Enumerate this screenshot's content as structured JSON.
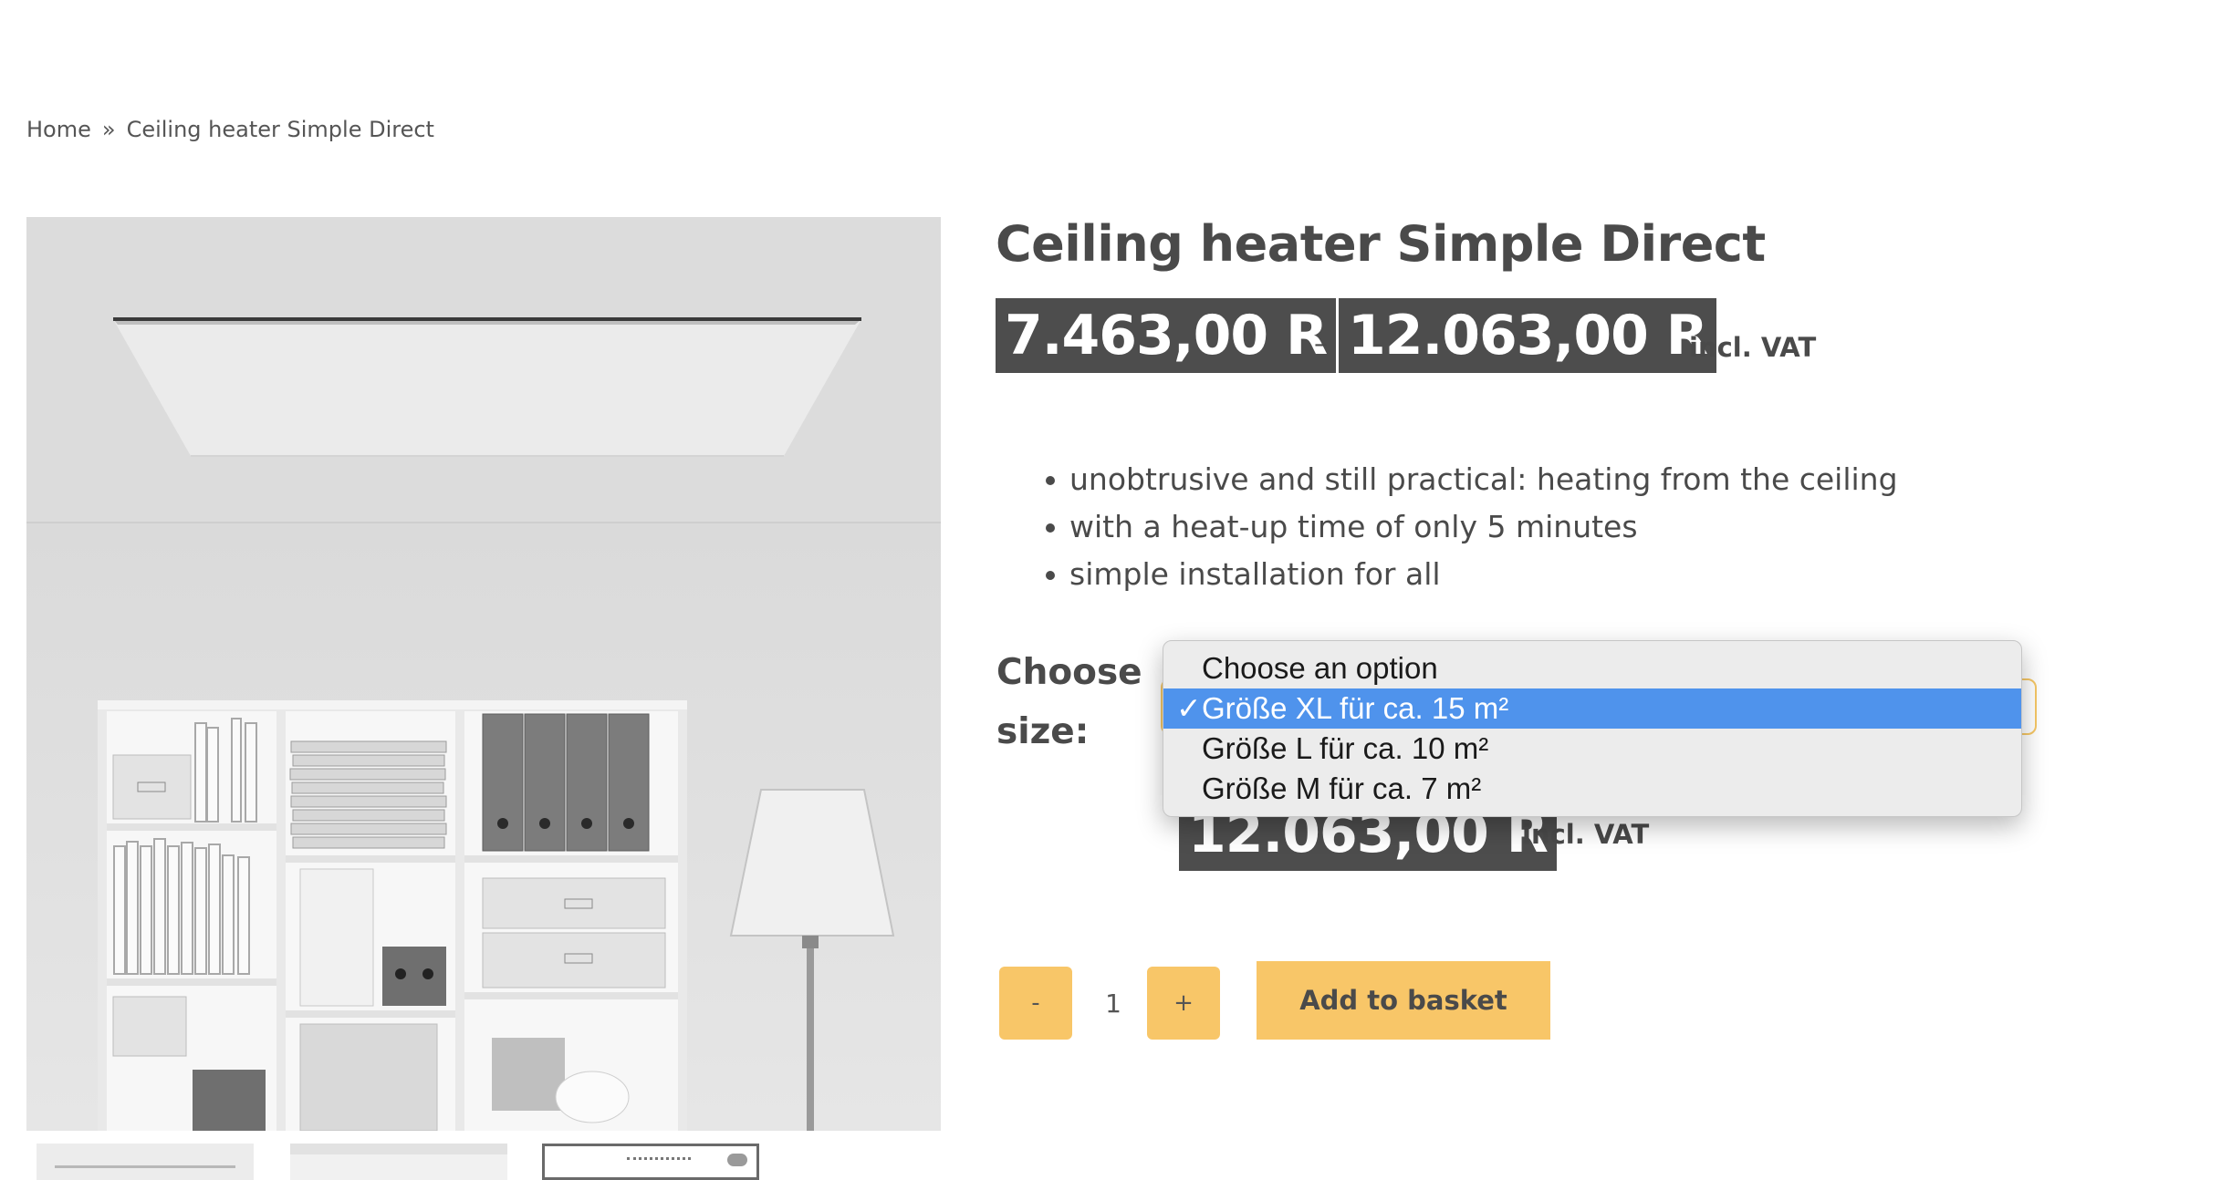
{
  "breadcrumb": {
    "home": "Home",
    "separator": "»",
    "current": "Ceiling heater Simple Direct"
  },
  "product": {
    "title": "Ceiling heater Simple Direct",
    "price_min": "7.463,00 R",
    "price_separator": "–",
    "price_max": "12.063,00 R",
    "vat_note": "incl. VAT",
    "features": [
      "unobtrusive and still practical: heating from the ceiling",
      "with a heat-up time of only 5 minutes",
      "simple installation for all"
    ]
  },
  "variation": {
    "label_line1": "Choose",
    "label_line2": "size:",
    "options": [
      {
        "label": "Choose an option",
        "selected": false
      },
      {
        "label": "Größe XL für ca. 15 m²",
        "selected": true
      },
      {
        "label": "Größe L für ca. 10 m²",
        "selected": false
      },
      {
        "label": "Größe M für ca. 7 m²",
        "selected": false
      }
    ],
    "check_mark": "✓",
    "selected_price": "12.063,00 R",
    "selected_vat_note": "incl. VAT"
  },
  "cart": {
    "minus_label": "-",
    "plus_label": "+",
    "quantity": "1",
    "add_label": "Add to basket"
  },
  "colors": {
    "accent": "#f8c668",
    "price_bg": "#4d4d4d",
    "dropdown_selected": "#4f93ec"
  }
}
